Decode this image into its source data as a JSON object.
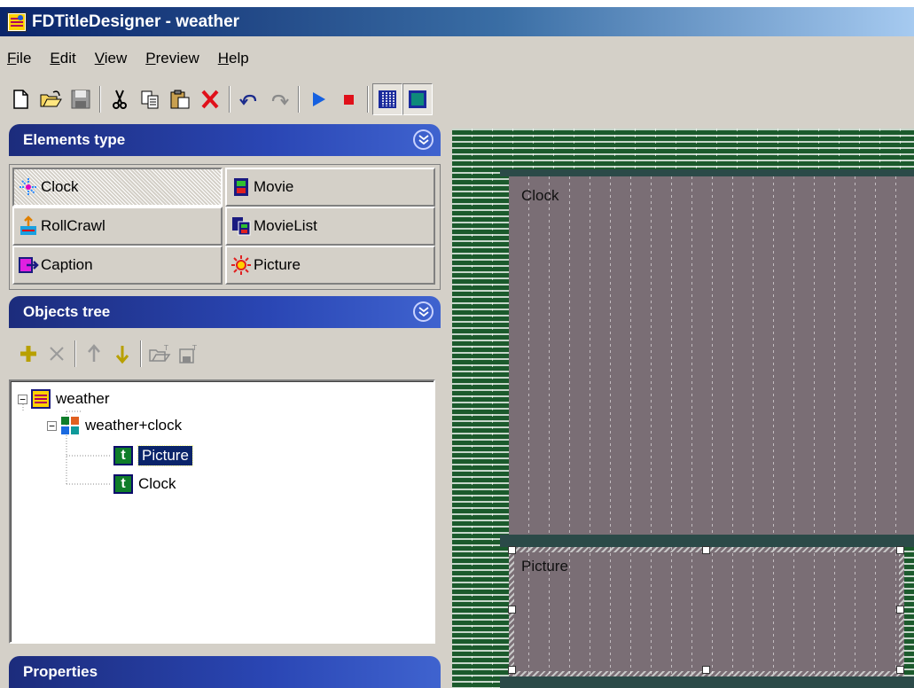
{
  "window": {
    "title": "FDTitleDesigner - weather"
  },
  "menu": [
    {
      "label": "File",
      "u": "F",
      "rest": "ile"
    },
    {
      "label": "Edit",
      "u": "E",
      "rest": "dit"
    },
    {
      "label": "View",
      "u": "V",
      "rest": "iew"
    },
    {
      "label": "Preview",
      "u": "P",
      "rest": "review"
    },
    {
      "label": "Help",
      "u": "H",
      "rest": "elp"
    }
  ],
  "toolbar": {
    "icons": [
      "new-file-icon",
      "open-folder-icon",
      "save-icon",
      "cut-icon",
      "copy-icon",
      "paste-icon",
      "delete-icon",
      "undo-icon",
      "redo-icon",
      "play-icon",
      "stop-icon",
      "grid-toggle-icon",
      "safe-area-icon"
    ]
  },
  "elements_panel": {
    "title": "Elements type",
    "items": [
      {
        "label": "Clock",
        "icon": "clock-element-icon",
        "active": true
      },
      {
        "label": "Movie",
        "icon": "movie-element-icon"
      },
      {
        "label": "RollCrawl",
        "icon": "rollcrawl-element-icon"
      },
      {
        "label": "MovieList",
        "icon": "movielist-element-icon"
      },
      {
        "label": "Caption",
        "icon": "caption-element-icon"
      },
      {
        "label": "Picture",
        "icon": "picture-element-icon"
      }
    ]
  },
  "objects_panel": {
    "title": "Objects tree",
    "tree": {
      "root": "weather",
      "group": "weather+clock",
      "children": [
        "Picture",
        "Clock"
      ],
      "selected": "Picture"
    }
  },
  "properties_panel": {
    "title": "Properties"
  },
  "canvas": {
    "regions": [
      {
        "label": "Clock"
      },
      {
        "label": "Picture",
        "selected": true
      }
    ]
  },
  "colors": {
    "canvas_bg": "#1b5a2c",
    "region_fill": "#7a6e75",
    "panel_header": "#2a46b4",
    "selection": "#0a246a"
  }
}
